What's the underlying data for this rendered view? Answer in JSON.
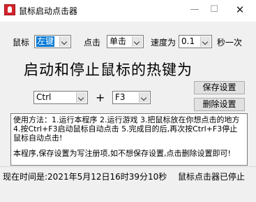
{
  "window": {
    "title": "鼠标启动点击器"
  },
  "titlebar": {
    "minimize": "—",
    "maximize": "☐",
    "close": "✕"
  },
  "controls": {
    "mouse_label": "鼠标",
    "mouse_button_value": "左键",
    "click_label": "点击",
    "click_type_value": "单击",
    "speed_label": "速度为",
    "speed_value": "0.1",
    "speed_unit": "秒一次"
  },
  "hotkey": {
    "heading": "启动和停止鼠标的热键为",
    "modifier_value": "Ctrl",
    "plus": "+",
    "key_value": "F3"
  },
  "buttons": {
    "save": "保存设置",
    "delete": "删除设置"
  },
  "help": {
    "line1": "使用方法：1.运行本程序 2.运行游戏 3.把鼠标放在你想点击的地方 4.按Ctrl+F3启动鼠标自动点击 5.完成目的后,再次按Ctrl+F3停止鼠标自动点击!",
    "line2": "本程序,保存设置为写注册项,如不想保存设置,点击删除设置即可!"
  },
  "status": {
    "time": "现在时间是:2021年5月12日16时39分10秒",
    "state": "鼠标点击器已停止"
  }
}
